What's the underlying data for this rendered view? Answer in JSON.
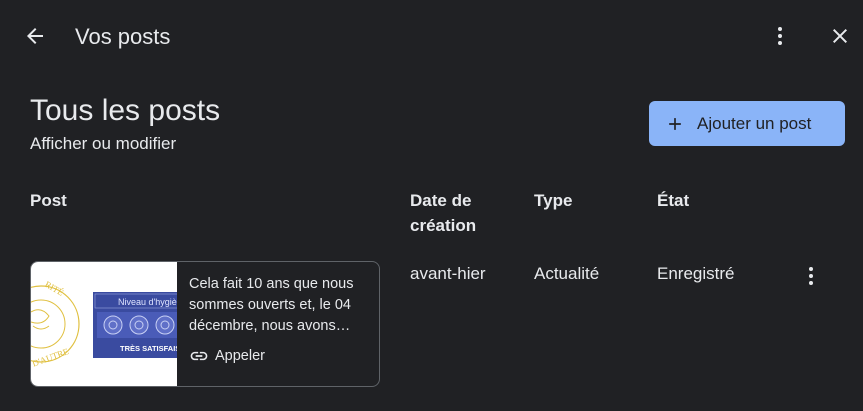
{
  "topbar": {
    "back_icon": "arrow-left-icon",
    "title": "Vos posts",
    "more_icon": "more-vert-icon",
    "close_icon": "close-icon"
  },
  "header": {
    "title": "Tous les posts",
    "subtitle": "Afficher ou modifier",
    "add_button": "Ajouter un post",
    "add_icon": "plus-icon"
  },
  "table": {
    "columns": {
      "post": "Post",
      "date": "Date de création",
      "type": "Type",
      "state": "État"
    },
    "rows": [
      {
        "thumbnail": {
          "badge_title": "Niveau d'hygiè",
          "badge_rating": "TRÈS SATISFAISA",
          "seal_text": "RITÉ",
          "seal_bottom": "D'AUTRE"
        },
        "text": "Cela fait 10 ans que nous sommes ouverts et, le 04 décembre, nous avons…",
        "action_label": "Appeler",
        "action_icon": "link-icon",
        "date": "avant-hier",
        "type": "Actualité",
        "state": "Enregistré",
        "more_icon": "more-vert-icon"
      }
    ]
  },
  "colors": {
    "background": "#202124",
    "text": "#e8eaed",
    "accent_button": "#8ab4f8",
    "card_border": "#5f6368",
    "badge_blue": "#3a4ba0",
    "seal_gold": "#e0c040"
  }
}
